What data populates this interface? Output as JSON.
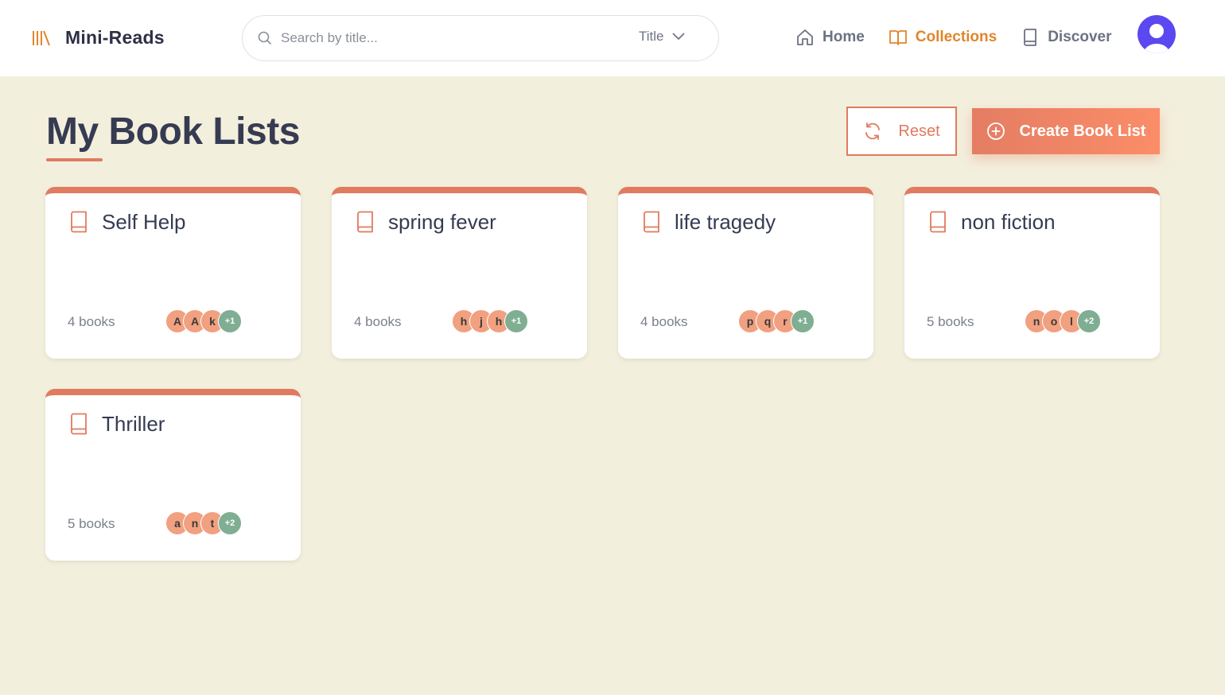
{
  "app": {
    "name": "Mini-Reads"
  },
  "search": {
    "placeholder": "Search by title...",
    "value": "",
    "filter_label": "Title"
  },
  "nav": {
    "items": [
      {
        "label": "Home",
        "icon": "home-icon",
        "active": false
      },
      {
        "label": "Collections",
        "icon": "open-book-icon",
        "active": true
      },
      {
        "label": "Discover",
        "icon": "book-icon",
        "active": false
      }
    ]
  },
  "page": {
    "title": "My Book Lists",
    "reset_label": "Reset",
    "create_label": "Create Book List"
  },
  "colors": {
    "accent": "#e07b5f",
    "nav_active": "#e0862b",
    "background": "#f3efdd",
    "avatar": "#5b48f0",
    "more_badge": "#7fae92"
  },
  "lists": [
    {
      "title": "Self Help",
      "count": "4 books",
      "initials": [
        "A",
        "A",
        "k"
      ],
      "more": "+1"
    },
    {
      "title": "spring fever",
      "count": "4 books",
      "initials": [
        "h",
        "j",
        "h"
      ],
      "more": "+1"
    },
    {
      "title": "life tragedy",
      "count": "4 books",
      "initials": [
        "p",
        "q",
        "r"
      ],
      "more": "+1"
    },
    {
      "title": "non fiction",
      "count": "5 books",
      "initials": [
        "n",
        "o",
        "l"
      ],
      "more": "+2"
    },
    {
      "title": "Thriller",
      "count": "5 books",
      "initials": [
        "a",
        "n",
        "t"
      ],
      "more": "+2"
    }
  ]
}
